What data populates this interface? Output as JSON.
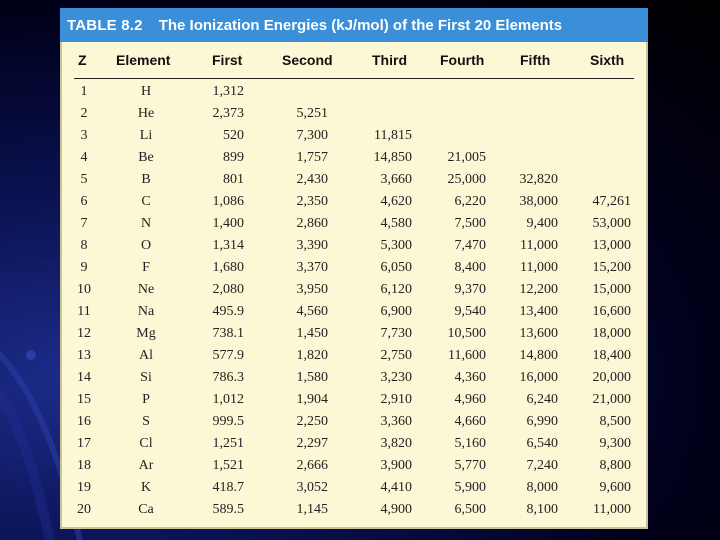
{
  "slide": {
    "background_color": "#0a1150",
    "accent_color": "#3a8fd8"
  },
  "table": {
    "number": "TABLE 8.2",
    "caption": "The Ionization Energies (kJ/mol) of the First 20 Elements",
    "headers": [
      "Z",
      "Element",
      "First",
      "Second",
      "Third",
      "Fourth",
      "Fifth",
      "Sixth"
    ],
    "rows": [
      [
        "1",
        "H",
        "1,312",
        "",
        "",
        "",
        "",
        ""
      ],
      [
        "2",
        "He",
        "2,373",
        "5,251",
        "",
        "",
        "",
        ""
      ],
      [
        "3",
        "Li",
        "520",
        "7,300",
        "11,815",
        "",
        "",
        ""
      ],
      [
        "4",
        "Be",
        "899",
        "1,757",
        "14,850",
        "21,005",
        "",
        ""
      ],
      [
        "5",
        "B",
        "801",
        "2,430",
        "3,660",
        "25,000",
        "32,820",
        ""
      ],
      [
        "6",
        "C",
        "1,086",
        "2,350",
        "4,620",
        "6,220",
        "38,000",
        "47,261"
      ],
      [
        "7",
        "N",
        "1,400",
        "2,860",
        "4,580",
        "7,500",
        "9,400",
        "53,000"
      ],
      [
        "8",
        "O",
        "1,314",
        "3,390",
        "5,300",
        "7,470",
        "11,000",
        "13,000"
      ],
      [
        "9",
        "F",
        "1,680",
        "3,370",
        "6,050",
        "8,400",
        "11,000",
        "15,200"
      ],
      [
        "10",
        "Ne",
        "2,080",
        "3,950",
        "6,120",
        "9,370",
        "12,200",
        "15,000"
      ],
      [
        "11",
        "Na",
        "495.9",
        "4,560",
        "6,900",
        "9,540",
        "13,400",
        "16,600"
      ],
      [
        "12",
        "Mg",
        "738.1",
        "1,450",
        "7,730",
        "10,500",
        "13,600",
        "18,000"
      ],
      [
        "13",
        "Al",
        "577.9",
        "1,820",
        "2,750",
        "11,600",
        "14,800",
        "18,400"
      ],
      [
        "14",
        "Si",
        "786.3",
        "1,580",
        "3,230",
        "4,360",
        "16,000",
        "20,000"
      ],
      [
        "15",
        "P",
        "1,012",
        "1,904",
        "2,910",
        "4,960",
        "6,240",
        "21,000"
      ],
      [
        "16",
        "S",
        "999.5",
        "2,250",
        "3,360",
        "4,660",
        "6,990",
        "8,500"
      ],
      [
        "17",
        "Cl",
        "1,251",
        "2,297",
        "3,820",
        "5,160",
        "6,540",
        "9,300"
      ],
      [
        "18",
        "Ar",
        "1,521",
        "2,666",
        "3,900",
        "5,770",
        "7,240",
        "8,800"
      ],
      [
        "19",
        "K",
        "418.7",
        "3,052",
        "4,410",
        "5,900",
        "8,000",
        "9,600"
      ],
      [
        "20",
        "Ca",
        "589.5",
        "1,145",
        "4,900",
        "6,500",
        "8,100",
        "11,000"
      ]
    ]
  }
}
